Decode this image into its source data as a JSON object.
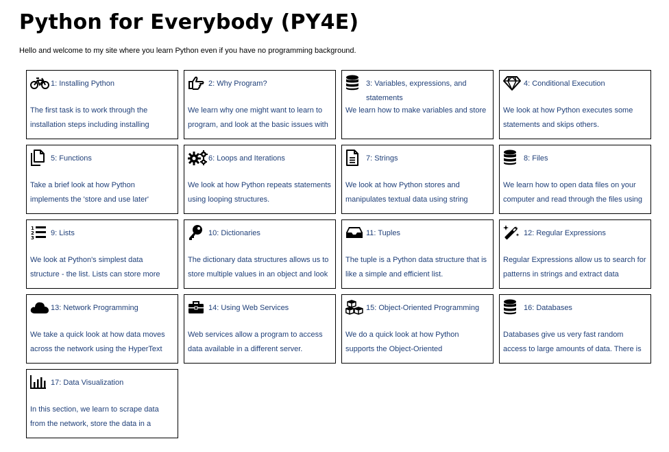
{
  "page": {
    "title": "Python for Everybody (PY4E)",
    "intro": "Hello and welcome to my site where you learn Python even if you have no programming background."
  },
  "lessons": [
    {
      "icon": "bicycle-icon",
      "title": "1: Installing Python",
      "desc": "The first task is to work through the installation steps including installing"
    },
    {
      "icon": "hand-pointing-icon",
      "title": "2: Why Program?",
      "desc": "We learn why one might want to learn to program, and look at the basic issues with"
    },
    {
      "icon": "database-icon",
      "title": "3: Variables, expressions, and statements",
      "desc": "We learn how to make variables and store"
    },
    {
      "icon": "diamond-icon",
      "title": "4: Conditional Execution",
      "desc": "We look at how Python executes some statements and skips others."
    },
    {
      "icon": "file-icon",
      "title": "5: Functions",
      "desc": "Take a brief look at how Python implements the 'store and use later'"
    },
    {
      "icon": "gears-icon",
      "title": "6: Loops and Iterations",
      "desc": "We look at how Python repeats statements using looping structures."
    },
    {
      "icon": "file-text-icon",
      "title": "7: Strings",
      "desc": "We look at how Python stores and manipulates textual data using string"
    },
    {
      "icon": "database-icon",
      "title": "8: Files",
      "desc": "We learn how to open data files on your computer and read through the files using"
    },
    {
      "icon": "numbered-list-icon",
      "title": "9: Lists",
      "desc": "We look at Python's simplest data structure - the list. Lists can store more"
    },
    {
      "icon": "key-icon",
      "title": "10: Dictionaries",
      "desc": "The dictionary data structures allows us to store multiple values in an object and look"
    },
    {
      "icon": "inbox-icon",
      "title": "11: Tuples",
      "desc": "The tuple is a Python data structure that is like a simple and efficient list."
    },
    {
      "icon": "magic-wand-icon",
      "title": "12: Regular Expressions",
      "desc": "Regular Expressions allow us to search for patterns in strings and extract data"
    },
    {
      "icon": "cloud-icon",
      "title": "13: Network Programming",
      "desc": "We take a quick look at how data moves across the network using the HyperText"
    },
    {
      "icon": "briefcase-icon",
      "title": "14: Using Web Services",
      "desc": "Web services allow a program to access data available in a different server."
    },
    {
      "icon": "cubes-icon",
      "title": "15: Object-Oriented Programming",
      "desc": "We do a quick look at how Python supports the Object-Oriented"
    },
    {
      "icon": "database-icon",
      "title": "16: Databases",
      "desc": "Databases give us very fast random access to large amounts of data. There is"
    },
    {
      "icon": "bar-chart-icon",
      "title": "17: Data Visualization",
      "desc": "In this section, we learn to scrape data from the network, store the data in a"
    }
  ],
  "colors": {
    "link": "#1f3f78",
    "border": "#000000",
    "text": "#000000"
  }
}
